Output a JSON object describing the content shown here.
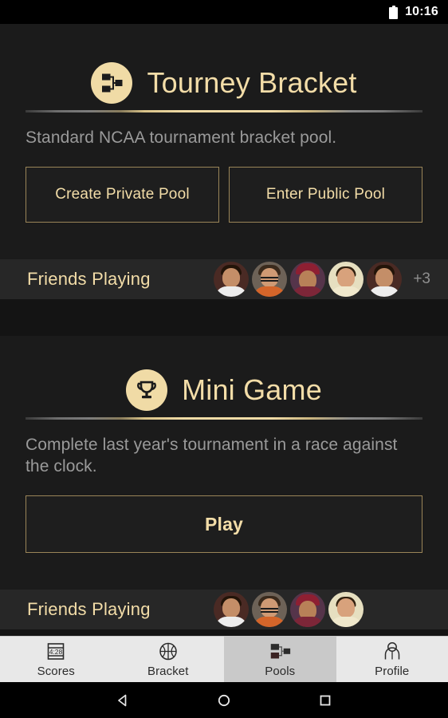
{
  "status_bar": {
    "time": "10:16",
    "battery_icon": "battery-icon"
  },
  "cards": [
    {
      "id": "tourney-bracket",
      "icon": "bracket-icon",
      "title": "Tourney Bracket",
      "description": "Standard NCAA tournament bracket pool.",
      "buttons": [
        {
          "label": "Create Private Pool",
          "name": "create-private-pool-button"
        },
        {
          "label": "Enter Public Pool",
          "name": "enter-public-pool-button"
        }
      ],
      "friends": {
        "label": "Friends Playing",
        "avatar_count": 5,
        "overflow": "+3"
      }
    },
    {
      "id": "mini-game",
      "icon": "trophy-icon",
      "title": "Mini Game",
      "description": "Complete last year's tournament in a race against the clock.",
      "buttons": [
        {
          "label": "Play",
          "name": "play-button"
        }
      ],
      "friends": {
        "label": "Friends Playing",
        "avatar_count": 4,
        "overflow": ""
      }
    }
  ],
  "tabbar": {
    "tabs": [
      {
        "label": "Scores",
        "icon": "scoreboard-icon",
        "icon_text": "4:28",
        "active": false
      },
      {
        "label": "Bracket",
        "icon": "basketball-icon",
        "active": false
      },
      {
        "label": "Pools",
        "icon": "bracket-icon",
        "active": true
      },
      {
        "label": "Profile",
        "icon": "person-icon",
        "active": false
      }
    ]
  },
  "navbar": {
    "back": "back-triangle-icon",
    "home": "home-circle-icon",
    "recents": "recents-square-icon"
  },
  "colors": {
    "accent_gold": "#f3dda8",
    "accent_border": "#9a8558",
    "card_bg": "#1b1b1b",
    "page_bg": "#141414",
    "friends_bg": "#272727",
    "muted_text": "#9a9a9a",
    "tabbar_bg": "#e8e8e8",
    "tab_active_bg": "#c9c9c9"
  }
}
